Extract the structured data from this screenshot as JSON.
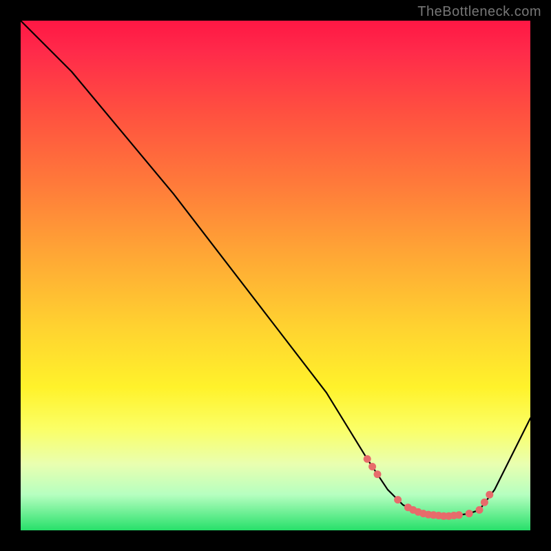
{
  "watermark": "TheBottleneck.com",
  "chart_data": {
    "type": "line",
    "title": "",
    "xlabel": "",
    "ylabel": "",
    "xlim": [
      0,
      100
    ],
    "ylim": [
      0,
      100
    ],
    "grid": false,
    "legend": false,
    "series": [
      {
        "name": "curve",
        "x": [
          0,
          6,
          10,
          20,
          30,
          40,
          50,
          60,
          68,
          72,
          75,
          78,
          80,
          82,
          84,
          86,
          88,
          90,
          93,
          100
        ],
        "y": [
          100,
          94,
          90,
          78,
          66,
          53,
          40,
          27,
          14,
          8,
          5,
          3.5,
          3,
          2.8,
          2.8,
          3,
          3.3,
          4,
          8,
          22
        ]
      }
    ],
    "markers": {
      "name": "dots",
      "x": [
        68,
        69,
        70,
        74,
        76,
        77,
        78,
        79,
        80,
        81,
        82,
        83,
        84,
        85,
        86,
        88,
        90,
        91,
        92
      ],
      "y": [
        14,
        12.5,
        11,
        6,
        4.5,
        4,
        3.6,
        3.3,
        3.1,
        3,
        2.9,
        2.8,
        2.8,
        2.9,
        3,
        3.3,
        4,
        5.5,
        7
      ]
    },
    "colors": {
      "line": "#000000",
      "dots": "#e76b6b",
      "gradient_top": "#ff1744",
      "gradient_mid": "#fff22b",
      "gradient_bottom": "#27e06a"
    }
  }
}
